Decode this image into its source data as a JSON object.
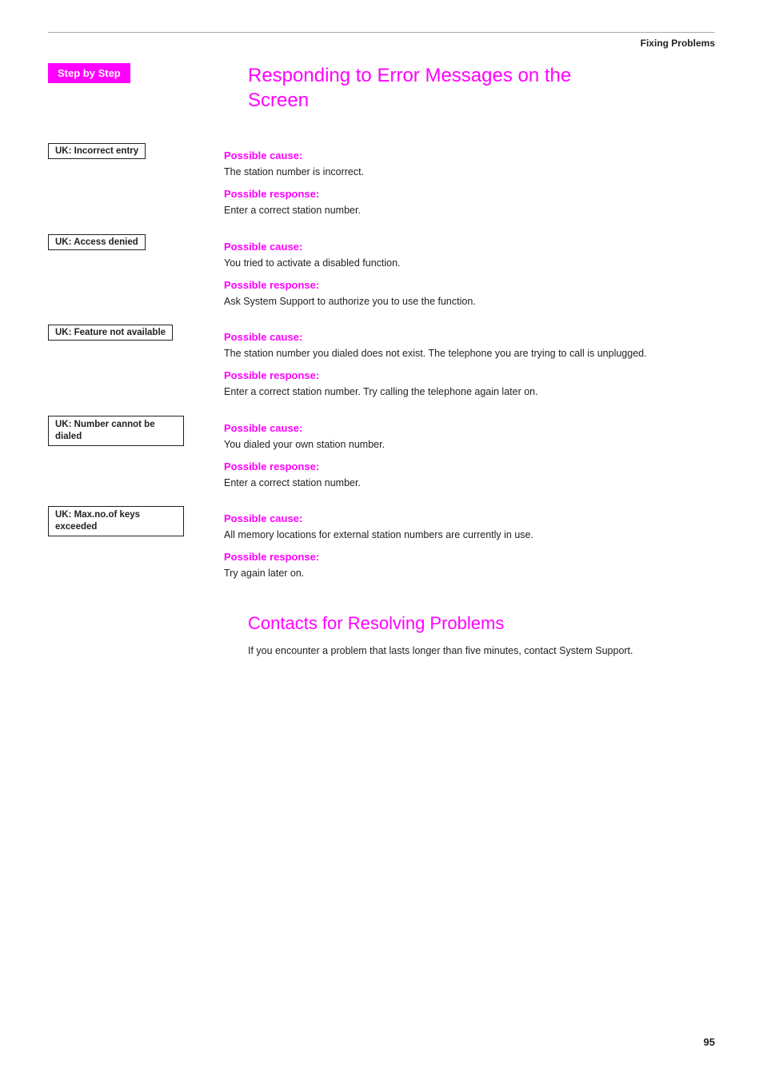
{
  "header": {
    "rule": true,
    "title": "Fixing Problems"
  },
  "sidebar": {
    "badge_label": "Step by Step"
  },
  "main_title_line1": "Responding to Error Messages on the",
  "main_title_line2": "Screen",
  "errors": [
    {
      "label": "UK: Incorrect entry",
      "cause_label": "Possible cause:",
      "cause_text": "The station number is incorrect.",
      "response_label": "Possible response:",
      "response_text": "Enter a correct station number."
    },
    {
      "label": "UK: Access denied",
      "cause_label": "Possible cause:",
      "cause_text": "You tried to activate a disabled function.",
      "response_label": "Possible response:",
      "response_text": "Ask System Support to authorize you to use the function."
    },
    {
      "label": "UK: Feature not available",
      "cause_label": "Possible cause:",
      "cause_text": "The station number you dialed does not exist. The telephone you are trying to call is unplugged.",
      "response_label": "Possible response:",
      "response_text": "Enter a correct station number. Try calling the telephone again later on."
    },
    {
      "label": "UK: Number cannot be dialed",
      "cause_label": "Possible cause:",
      "cause_text": "You dialed your own station number.",
      "response_label": "Possible response:",
      "response_text": "Enter a correct station number."
    },
    {
      "label": "UK: Max.no.of keys exceeded",
      "cause_label": "Possible cause:",
      "cause_text": "All memory locations for external station numbers are currently in use.",
      "response_label": "Possible response:",
      "response_text": "Try again later on."
    }
  ],
  "contacts": {
    "title": "Contacts for Resolving Problems",
    "body": "If you encounter a problem that lasts longer than five minutes, contact System Support."
  },
  "page_number": "95"
}
